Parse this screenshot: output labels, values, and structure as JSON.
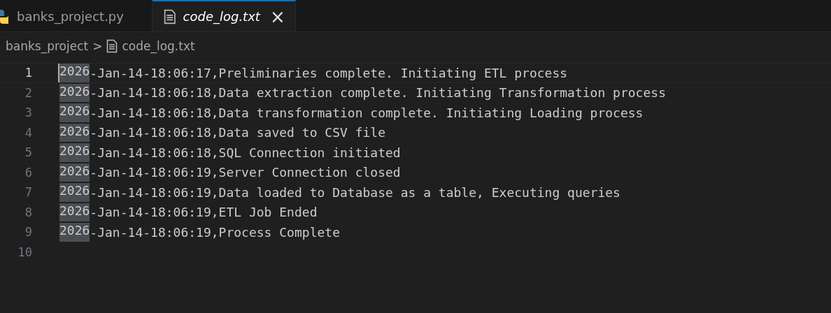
{
  "tabs": [
    {
      "label": "banks_project.py",
      "kind": "python",
      "selected": false,
      "italic": false
    },
    {
      "label": "code_log.txt",
      "kind": "text",
      "selected": true,
      "italic": true,
      "close": "×"
    }
  ],
  "breadcrumb": {
    "folder": "banks_project",
    "separator": ">",
    "file": "code_log.txt"
  },
  "editor": {
    "lines": [
      {
        "number": "1",
        "selected_text": "2026",
        "text": "-Jan-14-18:06:17,Preliminaries complete. Initiating ETL process",
        "current": true
      },
      {
        "number": "2",
        "selected_text": "2026",
        "text": "-Jan-14-18:06:18,Data extraction complete. Initiating Transformation process",
        "current": false
      },
      {
        "number": "3",
        "selected_text": "2026",
        "text": "-Jan-14-18:06:18,Data transformation complete. Initiating Loading process",
        "current": false
      },
      {
        "number": "4",
        "selected_text": "2026",
        "text": "-Jan-14-18:06:18,Data saved to CSV file",
        "current": false
      },
      {
        "number": "5",
        "selected_text": "2026",
        "text": "-Jan-14-18:06:18,SQL Connection initiated",
        "current": false
      },
      {
        "number": "6",
        "selected_text": "2026",
        "text": "-Jan-14-18:06:19,Server Connection closed",
        "current": false
      },
      {
        "number": "7",
        "selected_text": "2026",
        "text": "-Jan-14-18:06:19,Data loaded to Database as a table, Executing queries",
        "current": false
      },
      {
        "number": "8",
        "selected_text": "2026",
        "text": "-Jan-14-18:06:19,ETL Job Ended",
        "current": false
      },
      {
        "number": "9",
        "selected_text": "2026",
        "text": "-Jan-14-18:06:19,Process Complete",
        "current": false
      },
      {
        "number": "10",
        "current": false
      }
    ]
  }
}
